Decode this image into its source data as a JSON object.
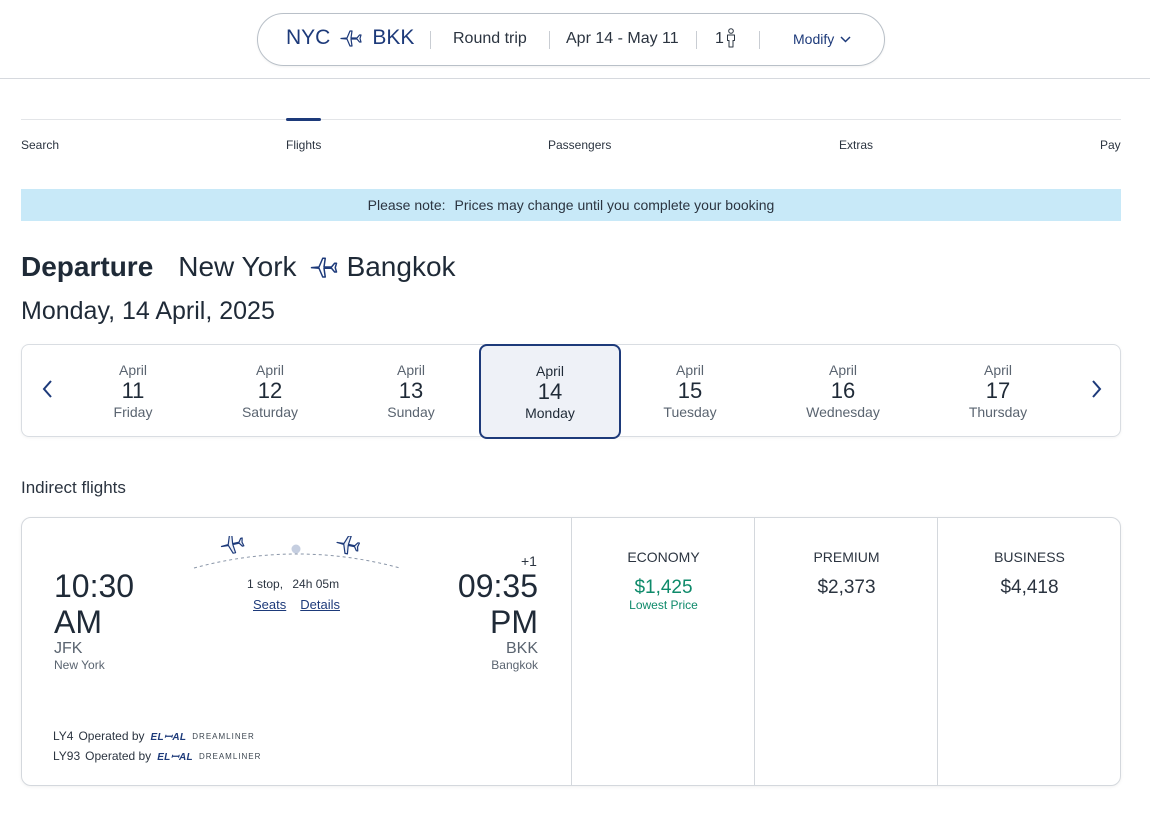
{
  "search_summary": {
    "origin": "NYC",
    "destination": "BKK",
    "trip_type": "Round trip",
    "dates": "Apr 14 - May 11",
    "passengers": "1",
    "modify_label": "Modify"
  },
  "steps": [
    "Search",
    "Flights",
    "Passengers",
    "Extras",
    "Pay"
  ],
  "notice": {
    "label": "Please note:",
    "text": "Prices may change until you complete your booking"
  },
  "heading": {
    "direction": "Departure",
    "from_city": "New York",
    "to_city": "Bangkok",
    "date": "Monday, 14 April, 2025"
  },
  "date_strip": [
    {
      "month": "April",
      "day": "11",
      "weekday": "Friday"
    },
    {
      "month": "April",
      "day": "12",
      "weekday": "Saturday"
    },
    {
      "month": "April",
      "day": "13",
      "weekday": "Sunday"
    },
    {
      "month": "April",
      "day": "14",
      "weekday": "Monday"
    },
    {
      "month": "April",
      "day": "15",
      "weekday": "Tuesday"
    },
    {
      "month": "April",
      "day": "16",
      "weekday": "Wednesday"
    },
    {
      "month": "April",
      "day": "17",
      "weekday": "Thursday"
    }
  ],
  "section_title": "Indirect flights",
  "flight": {
    "depart_time_line1": "10:30",
    "depart_time_line2": "AM",
    "depart_code": "JFK",
    "depart_city": "New York",
    "arrive_time_line1": "09:35",
    "arrive_time_line2": "PM",
    "arrive_code": "BKK",
    "arrive_city": "Bangkok",
    "day_offset": "+1",
    "stops": "1 stop,",
    "duration": "24h 05m",
    "seats_link": "Seats",
    "details_link": "Details",
    "operators": [
      {
        "flight": "LY4",
        "text": "Operated by",
        "logo_text": "ELꟷAL",
        "logo_sub": "DREAMLINER"
      },
      {
        "flight": "LY93",
        "text": "Operated by",
        "logo_text": "ELꟷAL",
        "logo_sub": "DREAMLINER"
      }
    ]
  },
  "fares": [
    {
      "class": "ECONOMY",
      "price": "$1,425",
      "note": "Lowest Price"
    },
    {
      "class": "PREMIUM",
      "price": "$2,373"
    },
    {
      "class": "BUSINESS",
      "price": "$4,418"
    }
  ],
  "colors": {
    "brand": "#1d3a7a",
    "notice_bg": "#c8e9f8",
    "lowest_price": "#0e8a6a"
  }
}
